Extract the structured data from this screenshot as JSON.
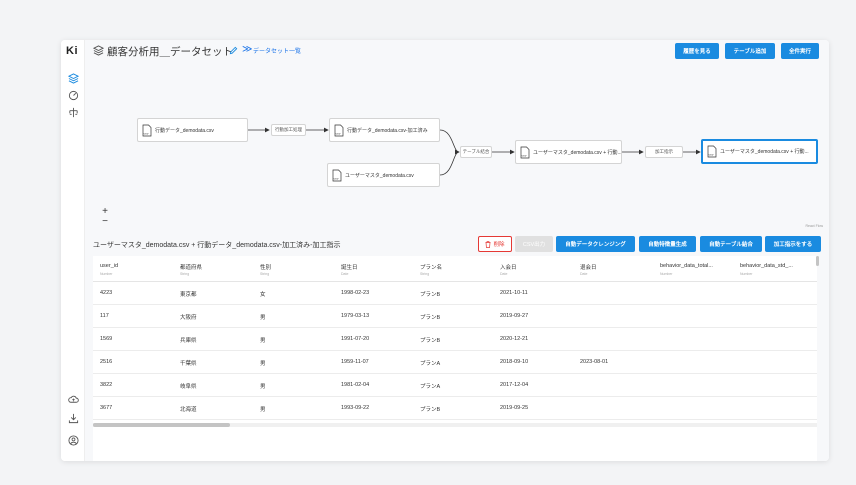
{
  "app": {
    "logo": "Ki"
  },
  "header": {
    "title": "顧客分析用＿データセット",
    "breadcrumb_sep": "≫",
    "breadcrumb_link": "データセット一覧",
    "buttons": {
      "history": "履歴を見る",
      "add_table": "テーブル追加",
      "run_all": "全件実行"
    }
  },
  "flow": {
    "nodes": {
      "n1": "行動データ_demodata.csv",
      "n2": "行動データ_demodata.csv-加工済み",
      "n3": "ユーザーマスタ_demodata.csv",
      "n4": "ユーザーマスタ_demodata.csv + 行動...",
      "n5": "ユーザーマスタ_demodata.csv + 行動..."
    },
    "ops": {
      "op1": "行動加工処理",
      "op2": "テーブル結合",
      "op3": "加工指示"
    },
    "zoom_in": "+",
    "zoom_out": "−",
    "watermark": "React Flow"
  },
  "dataset": {
    "name": "ユーザーマスタ_demodata.csv + 行動データ_demodata.csv-加工済み-加工指示",
    "buttons": {
      "delete": "削除",
      "csv_export": "CSV出力",
      "cleansing": "自動データクレンジング",
      "feature": "自動特徴量生成",
      "join": "自動テーブル結合",
      "instruct": "加工指示をする"
    }
  },
  "table": {
    "columns": [
      {
        "name": "user_id",
        "type": "Number"
      },
      {
        "name": "都道府県",
        "type": "String"
      },
      {
        "name": "性別",
        "type": "String"
      },
      {
        "name": "誕生日",
        "type": "Date"
      },
      {
        "name": "プラン名",
        "type": "String"
      },
      {
        "name": "入会日",
        "type": "Date"
      },
      {
        "name": "退会日",
        "type": "Date"
      },
      {
        "name": "behavior_data_total...",
        "type": "Number"
      },
      {
        "name": "behavior_data_std_...",
        "type": "Number"
      }
    ],
    "rows": [
      [
        "4223",
        "東京都",
        "女",
        "1998-02-23",
        "プランB",
        "2021-10-11",
        ""
      ],
      [
        "117",
        "大阪府",
        "男",
        "1979-03-13",
        "プランB",
        "2019-09-27",
        ""
      ],
      [
        "1569",
        "兵庫県",
        "男",
        "1991-07-20",
        "プランB",
        "2020-12-21",
        ""
      ],
      [
        "2516",
        "千葉県",
        "男",
        "1959-11-07",
        "プランA",
        "2018-09-10",
        "2023-08-01"
      ],
      [
        "3822",
        "岐阜県",
        "男",
        "1981-02-04",
        "プランA",
        "2017-12-04",
        ""
      ],
      [
        "3677",
        "北海道",
        "男",
        "1993-09-22",
        "プランB",
        "2019-09-25",
        ""
      ]
    ]
  },
  "colors": {
    "accent": "#1a8be0",
    "danger": "#e53935",
    "disabled": "#e0e0e0"
  }
}
